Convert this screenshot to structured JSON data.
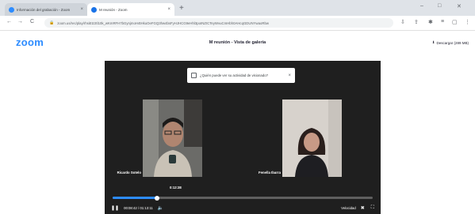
{
  "browser": {
    "tabs": [
      {
        "title": "Información del grabación - Zoom",
        "active": false
      },
      {
        "title": "M reunión - Zoom",
        "active": true
      }
    ],
    "new_tab_label": "+",
    "window_controls": {
      "minimize": "–",
      "maximize": "□",
      "close": "✕"
    },
    "nav": {
      "back": "←",
      "forward": "→",
      "reload": "C"
    },
    "url": "zoom.us/rec/play/rhsiEtz2tl10k_wKmRFH7bGynjmoH4tHkuOeFGQ3hw4bsFyHJHCG9eHhl3poINZICTeyWvuCmHbh0AHcqGDUNYwaoRbw"
  },
  "zoom": {
    "logo_text": "zoom",
    "title": "M reunión - Vista de galería",
    "download_label": "Descargar (289 MB)",
    "download_icon": "download-icon"
  },
  "player": {
    "popup_text": "¿Quién puede ver su actividad de visionado?",
    "participants": [
      {
        "name": "Ricardo Sotelo"
      },
      {
        "name": "Fenella Ibarra"
      }
    ],
    "time_bubble": "0:12:38",
    "current_time": "00:08:42",
    "total_time": "01:13:11",
    "progress": 0.17,
    "speed_label": "Velocidad",
    "colors": {
      "accent": "#2d8cff",
      "background": "#1f1f1f"
    }
  }
}
